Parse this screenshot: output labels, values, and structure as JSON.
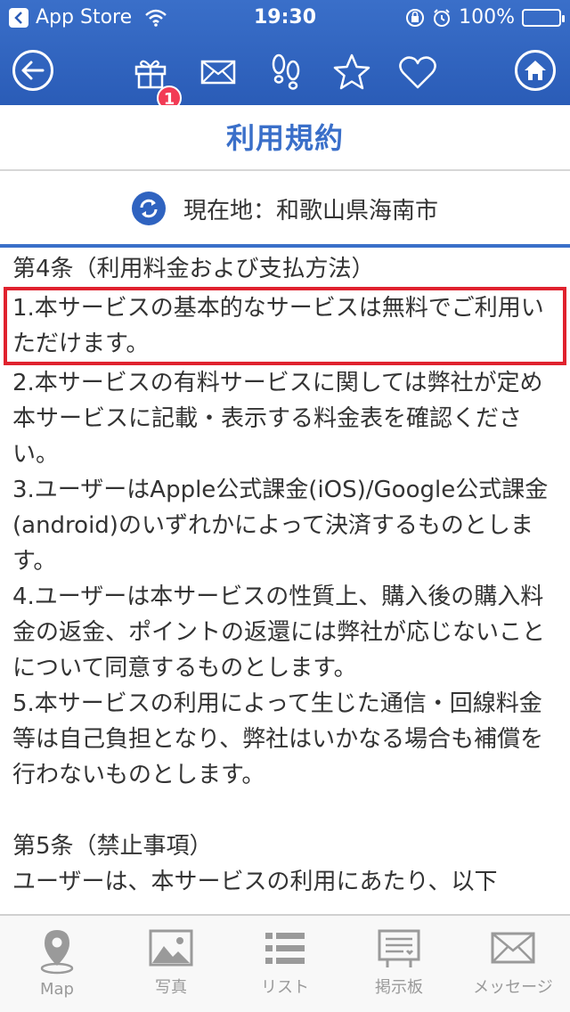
{
  "status_bar": {
    "left_label": "App Store",
    "time": "19:30",
    "battery": "100%"
  },
  "nav": {
    "badge_count": "1"
  },
  "title": "利用規約",
  "location": {
    "label": "現在地：和歌山県海南市"
  },
  "content": {
    "section4_heading": "第4条（利用料金および支払方法）",
    "item1": "1.本サービスの基本的なサービスは無料でご利用いただけます。",
    "item2": "2.本サービスの有料サービスに関しては弊社が定め本サービスに記載・表示する料金表を確認ください。",
    "item3": "3.ユーザーはApple公式課金(iOS)/Google公式課金(android)のいずれかによって決済するものとします。",
    "item4": "4.ユーザーは本サービスの性質上、購入後の購入料金の返金、ポイントの返還には弊社が応じないことについて同意するものとします。",
    "item5": "5.本サービスの利用によって生じた通信・回線料金等は自己負担となり、弊社はいかなる場合も補償を行わないものとします。",
    "section5_heading": "第5条（禁止事項）",
    "section5_text": "ユーザーは、本サービスの利用にあたり、以下"
  },
  "tabs": [
    {
      "label": "Map"
    },
    {
      "label": "写真"
    },
    {
      "label": "リスト"
    },
    {
      "label": "掲示板"
    },
    {
      "label": "メッセージ"
    }
  ],
  "colors": {
    "header": "#2a5cb7",
    "title": "#3a6fc9",
    "highlight": "#e0222e",
    "badge": "#f23b55"
  }
}
